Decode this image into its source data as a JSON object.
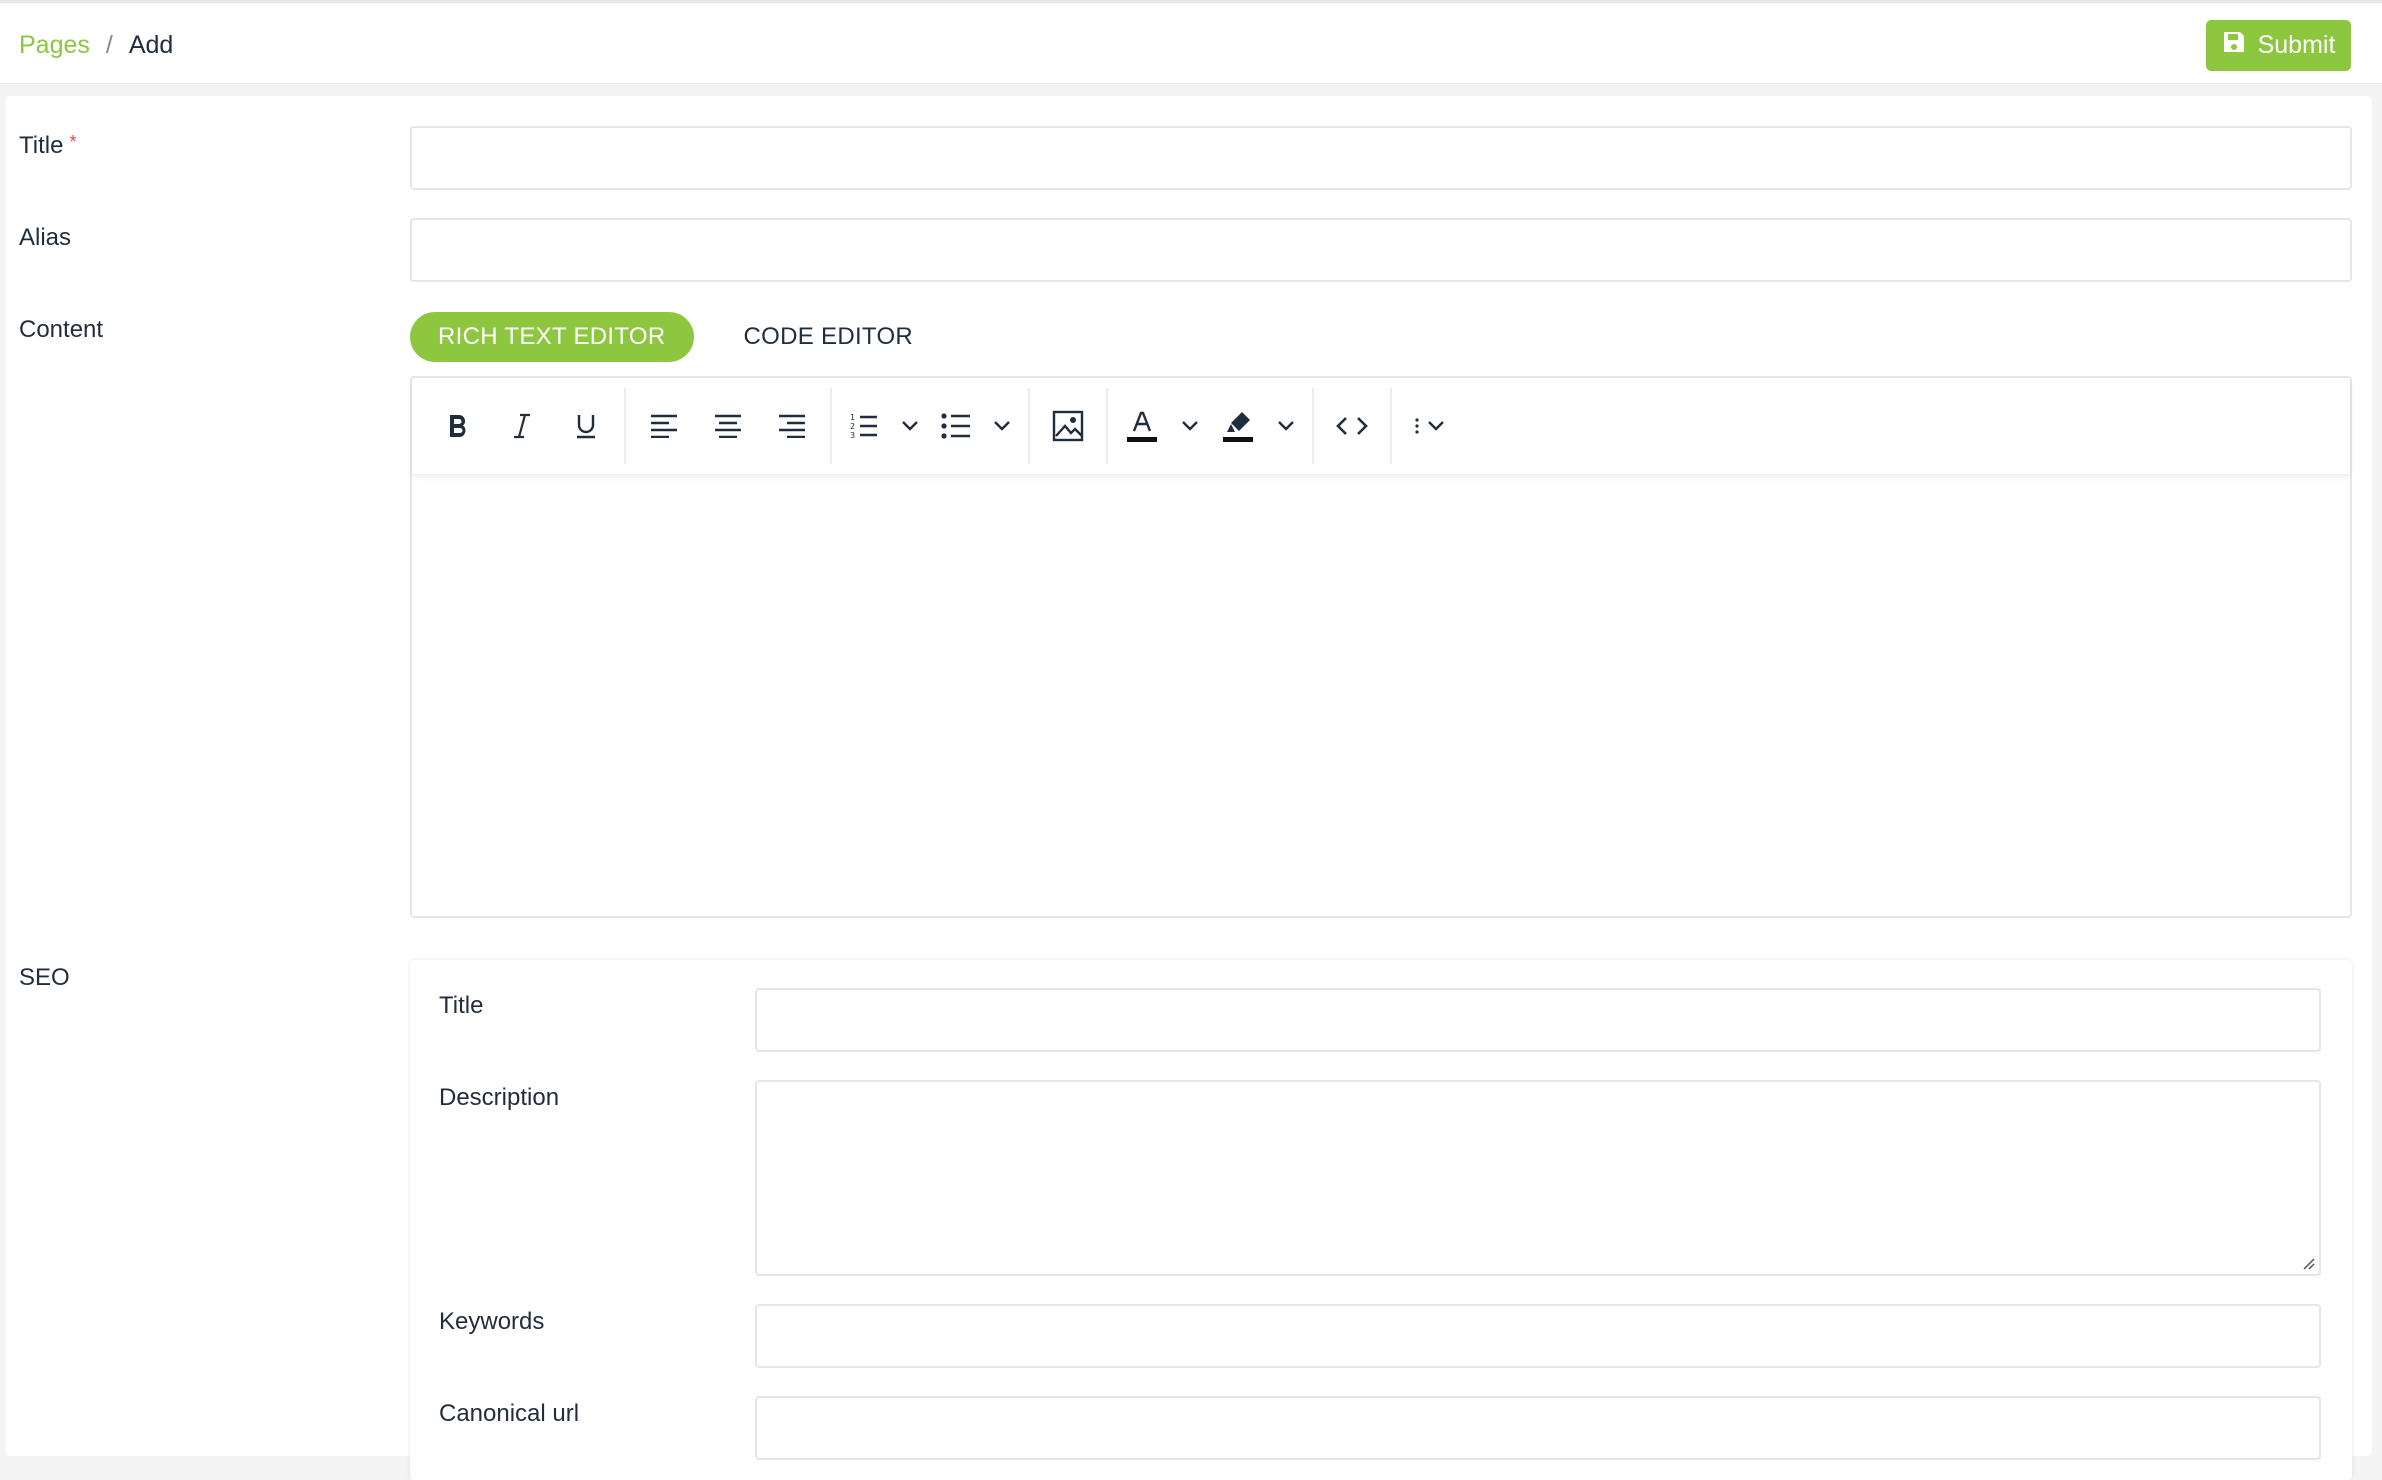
{
  "breadcrumb": {
    "parent": "Pages",
    "separator": "/",
    "current": "Add"
  },
  "header": {
    "submit_label": "Submit"
  },
  "form": {
    "title_label": "Title",
    "required_mark": "*",
    "title_value": "",
    "alias_label": "Alias",
    "alias_value": "",
    "content_label": "Content",
    "seo_label": "SEO"
  },
  "editor": {
    "tabs": [
      "RICH TEXT EDITOR",
      "CODE EDITOR"
    ],
    "active_tab": "RICH TEXT EDITOR",
    "toolbar_icons": [
      "bold-icon",
      "italic-icon",
      "underline-icon",
      "align-left-icon",
      "align-center-icon",
      "align-right-icon",
      "ordered-list-icon",
      "bullet-list-icon",
      "image-icon",
      "text-color-icon",
      "highlight-icon",
      "code-view-icon",
      "more-icon"
    ],
    "content": ""
  },
  "seo": {
    "title_label": "Title",
    "title_value": "",
    "description_label": "Description",
    "description_value": "",
    "keywords_label": "Keywords",
    "keywords_value": "",
    "canonical_label": "Canonical url",
    "canonical_value": ""
  },
  "colors": {
    "accent": "#8dc63f",
    "required": "#e84b3c",
    "border": "#e6e6e6",
    "text": "#1f2d3d"
  }
}
